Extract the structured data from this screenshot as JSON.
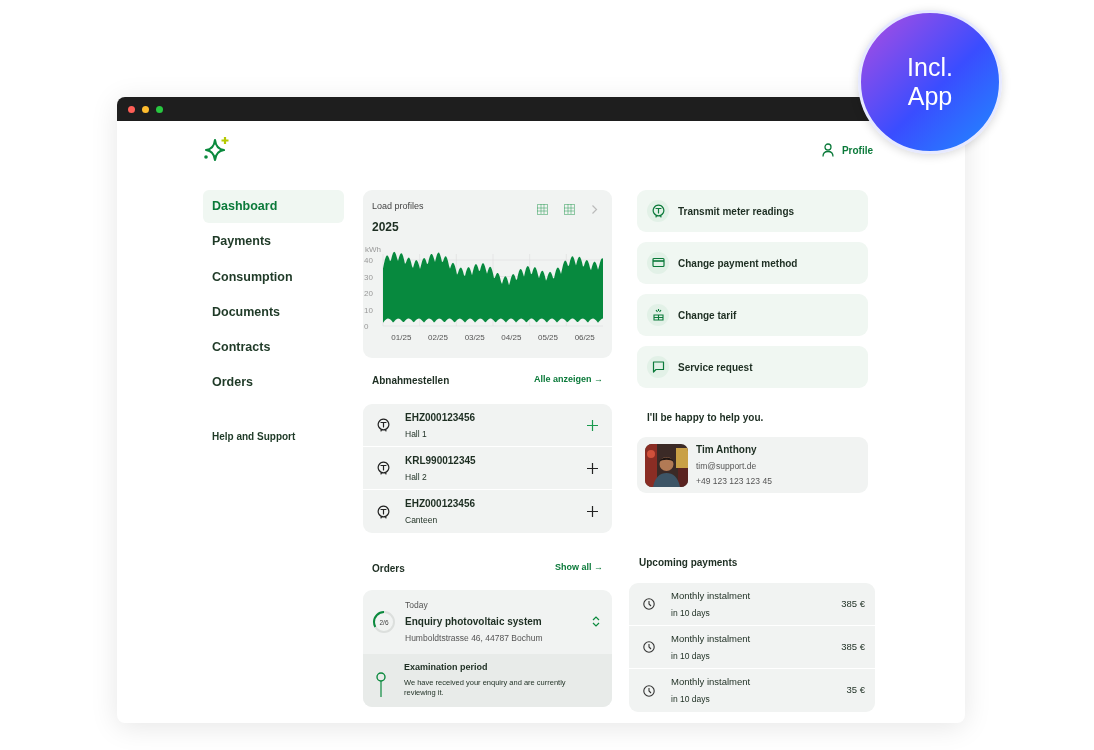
{
  "badge": {
    "text": "Incl. App"
  },
  "header": {
    "profile": "Profile"
  },
  "sidebar": {
    "items": [
      {
        "label": "Dashboard",
        "selected": true
      },
      {
        "label": "Payments",
        "selected": false
      },
      {
        "label": "Consumption",
        "selected": false
      },
      {
        "label": "Documents",
        "selected": false
      },
      {
        "label": "Contracts",
        "selected": false
      },
      {
        "label": "Orders",
        "selected": false
      }
    ],
    "help": "Help and Support"
  },
  "load_profiles": {
    "title": "Load profiles",
    "year": "2025",
    "unit": "kWh",
    "y_labels": [
      "40",
      "30",
      "20",
      "10",
      "0"
    ],
    "x_labels": [
      "01/25",
      "02/25",
      "03/25",
      "04/25",
      "05/25",
      "06/25"
    ]
  },
  "delivery_points": {
    "title": "Abnahmestellen",
    "link": "Alle anzeigen →",
    "rows": [
      {
        "id": "EHZ000123456",
        "name": "Hall 1",
        "highlighted": true
      },
      {
        "id": "KRL990012345",
        "name": "Hall 2",
        "highlighted": false
      },
      {
        "id": "EHZ000123456",
        "name": "Canteen",
        "highlighted": false
      }
    ]
  },
  "actions": [
    {
      "kind": "meter",
      "label": "Transmit meter readings"
    },
    {
      "kind": "card",
      "label": "Change payment method"
    },
    {
      "kind": "tarif",
      "label": "Change tarif"
    },
    {
      "kind": "chat",
      "label": "Service request"
    }
  ],
  "support": {
    "heading": "I'll be happy to help you.",
    "name": "Tim Anthony",
    "email": "tim@support.de",
    "phone": "+49 123 123 123 45"
  },
  "orders": {
    "title": "Orders",
    "link": "Show all →",
    "items": [
      {
        "progress": "2/6",
        "level": 0.33,
        "date": "Today",
        "title": "Enquiry photovoltaic system",
        "address": "Humboldtstrasse 46, 44787 Bochum",
        "expanded": true,
        "step": {
          "title": "Examination period",
          "text": "We have received your enquiry and are currently reviewing it."
        }
      }
    ]
  },
  "payments": {
    "title": "Upcoming payments",
    "items": [
      {
        "label": "Monthly instalment",
        "due": "in 10 days",
        "amount": "385 €"
      },
      {
        "label": "Monthly instalment",
        "due": "in 10 days",
        "amount": "385 €"
      },
      {
        "label": "Monthly instalment",
        "due": "in 10 days",
        "amount": "35 €"
      }
    ]
  }
}
